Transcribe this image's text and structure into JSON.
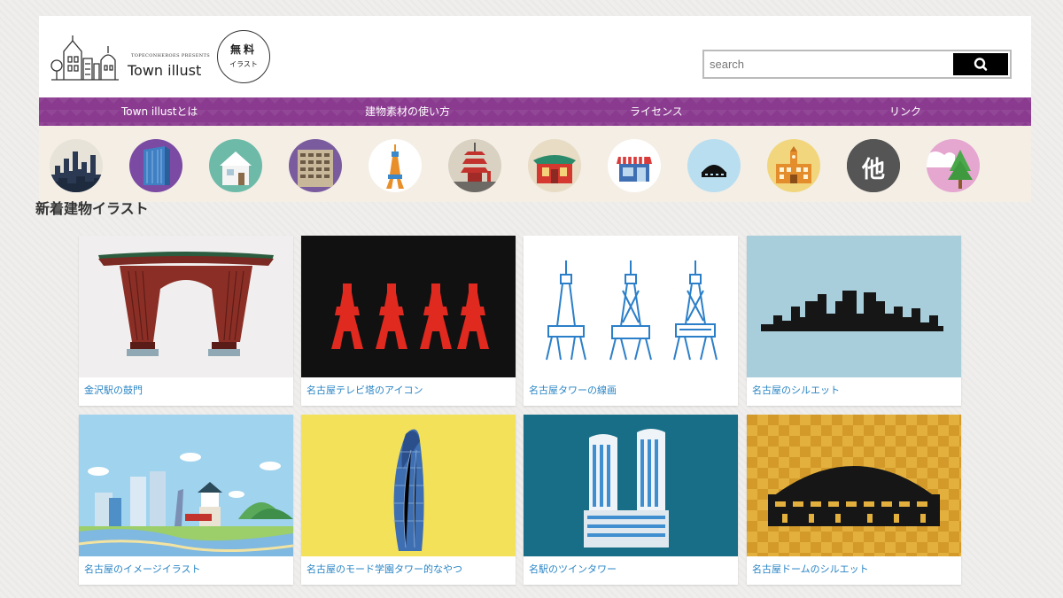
{
  "header": {
    "logo_sub": "TOPECONHEROES PRESENTS",
    "logo_title": "Town illust",
    "badge_line1": "無料",
    "badge_line2": "イラスト",
    "search_placeholder": "search"
  },
  "nav": [
    {
      "label": "Town illustとは"
    },
    {
      "label": "建物素材の使い方"
    },
    {
      "label": "ライセンス"
    },
    {
      "label": "リンク"
    }
  ],
  "categories": [
    {
      "name": "city-skyline-icon"
    },
    {
      "name": "office-building-icon"
    },
    {
      "name": "house-icon"
    },
    {
      "name": "apartment-icon"
    },
    {
      "name": "tower-icon"
    },
    {
      "name": "pagoda-icon"
    },
    {
      "name": "shrine-icon"
    },
    {
      "name": "shop-icon"
    },
    {
      "name": "dome-icon"
    },
    {
      "name": "school-icon"
    },
    {
      "name": "other-icon",
      "label": "他"
    },
    {
      "name": "tree-icon"
    }
  ],
  "section_title": "新着建物イラスト",
  "cards": [
    {
      "label": "金沢駅の鼓門"
    },
    {
      "label": "名古屋テレビ塔のアイコン"
    },
    {
      "label": "名古屋タワーの線画"
    },
    {
      "label": "名古屋のシルエット"
    },
    {
      "label": "名古屋のイメージイラスト"
    },
    {
      "label": "名古屋のモード学園タワー的なやつ"
    },
    {
      "label": "名駅のツインタワー"
    },
    {
      "label": "名古屋ドームのシルエット"
    }
  ],
  "colors": {
    "nav": "#8a3a8f",
    "link": "#2a85c5",
    "cat_strip": "#f4eee5"
  }
}
